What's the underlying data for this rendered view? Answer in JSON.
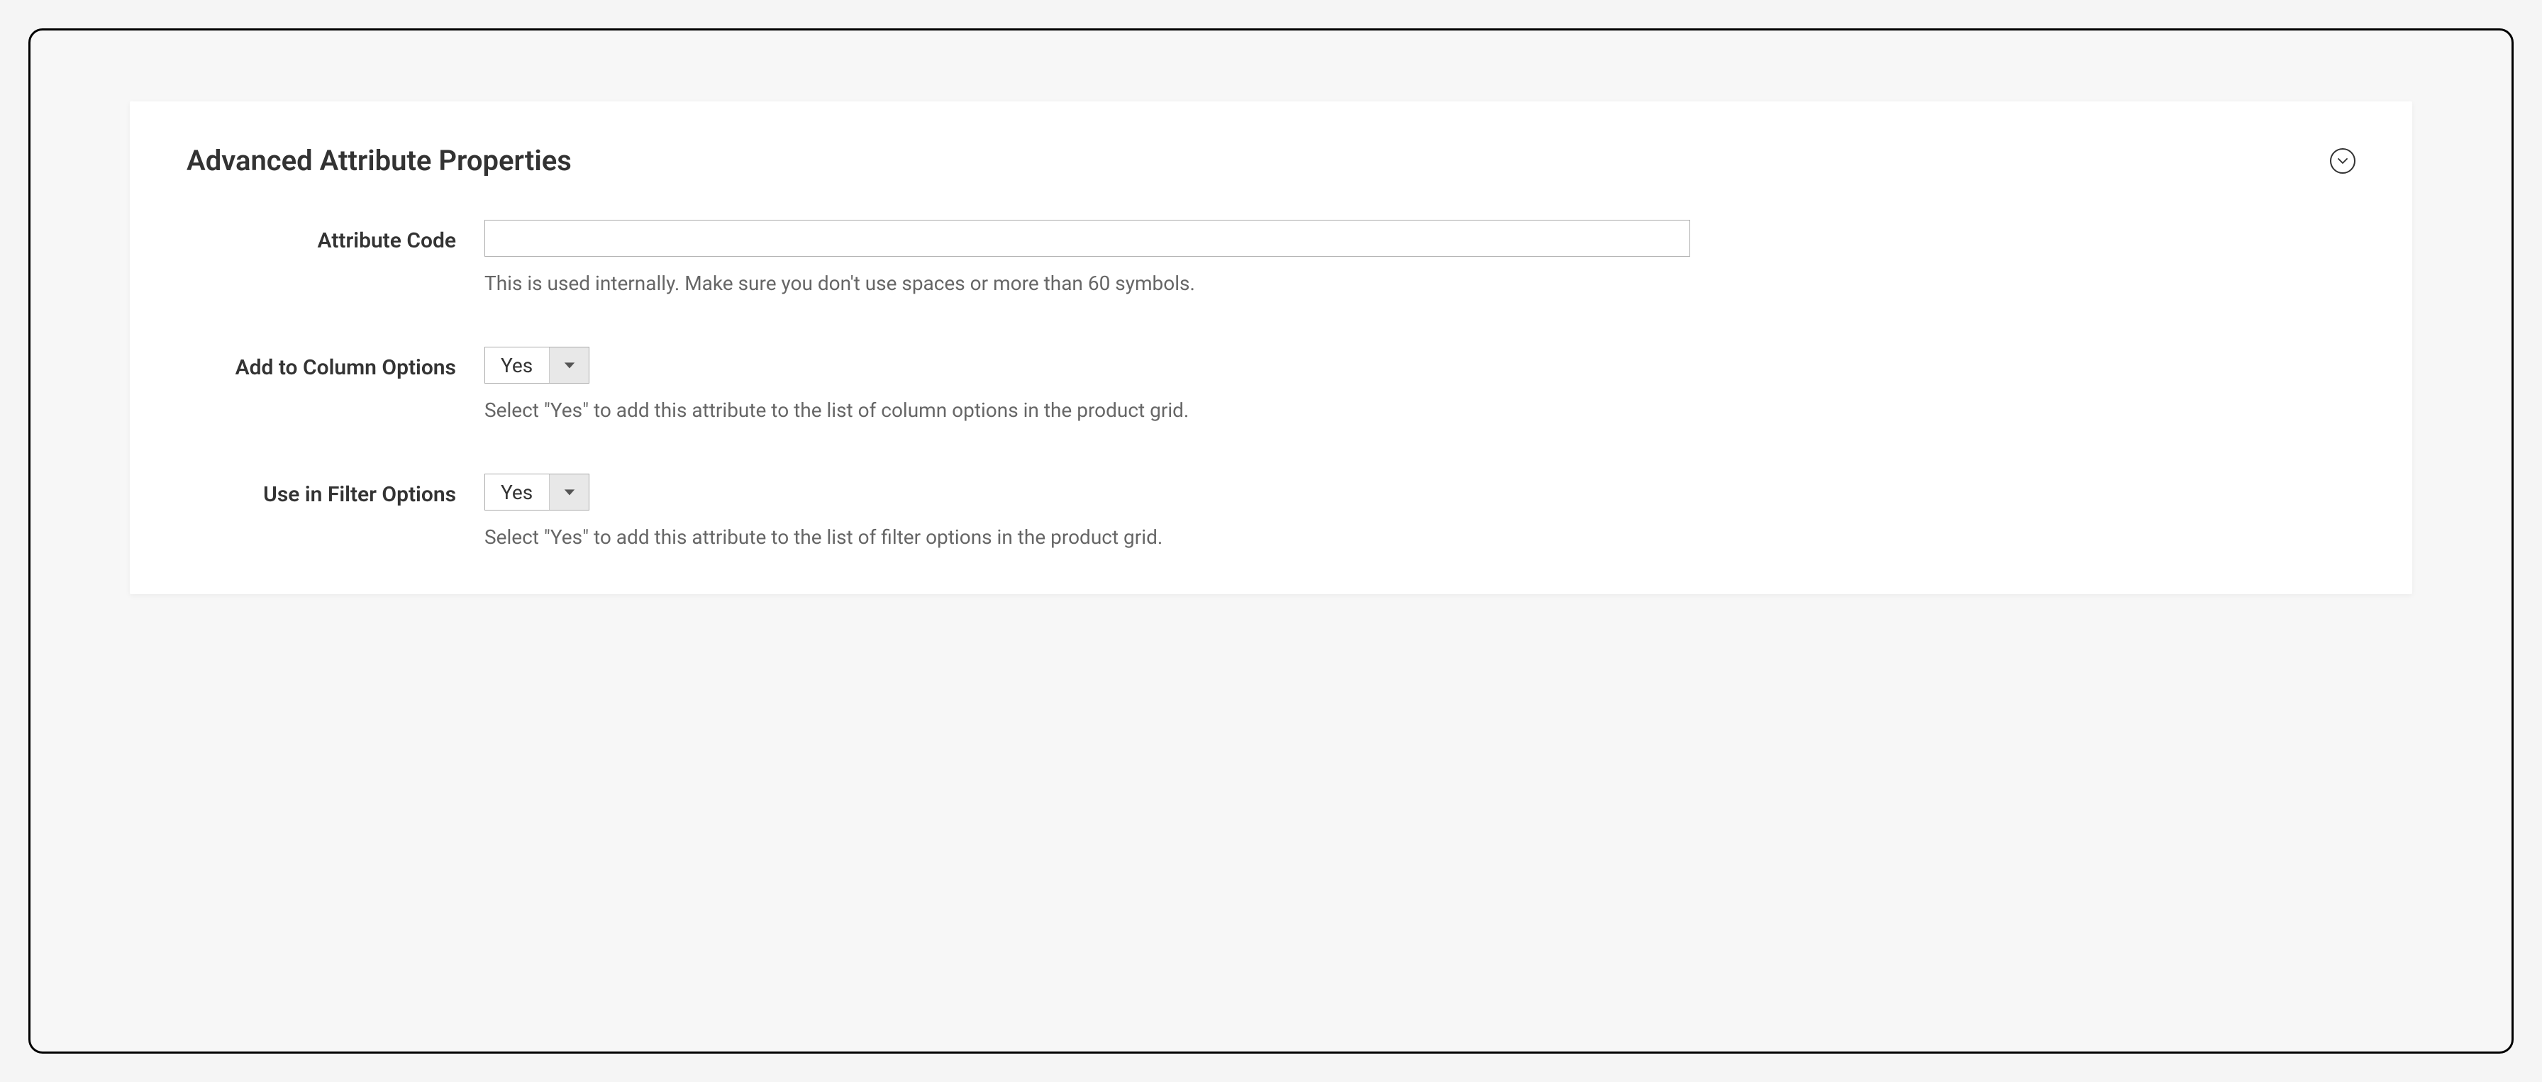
{
  "panel": {
    "title": "Advanced Attribute Properties"
  },
  "fields": {
    "attribute_code": {
      "label": "Attribute Code",
      "value": "",
      "help": "This is used internally. Make sure you don't use spaces or more than 60 symbols."
    },
    "add_to_column": {
      "label": "Add to Column Options",
      "value": "Yes",
      "help": "Select \"Yes\" to add this attribute to the list of column options in the product grid."
    },
    "use_in_filter": {
      "label": "Use in Filter Options",
      "value": "Yes",
      "help": "Select \"Yes\" to add this attribute to the list of filter options in the product grid."
    }
  }
}
